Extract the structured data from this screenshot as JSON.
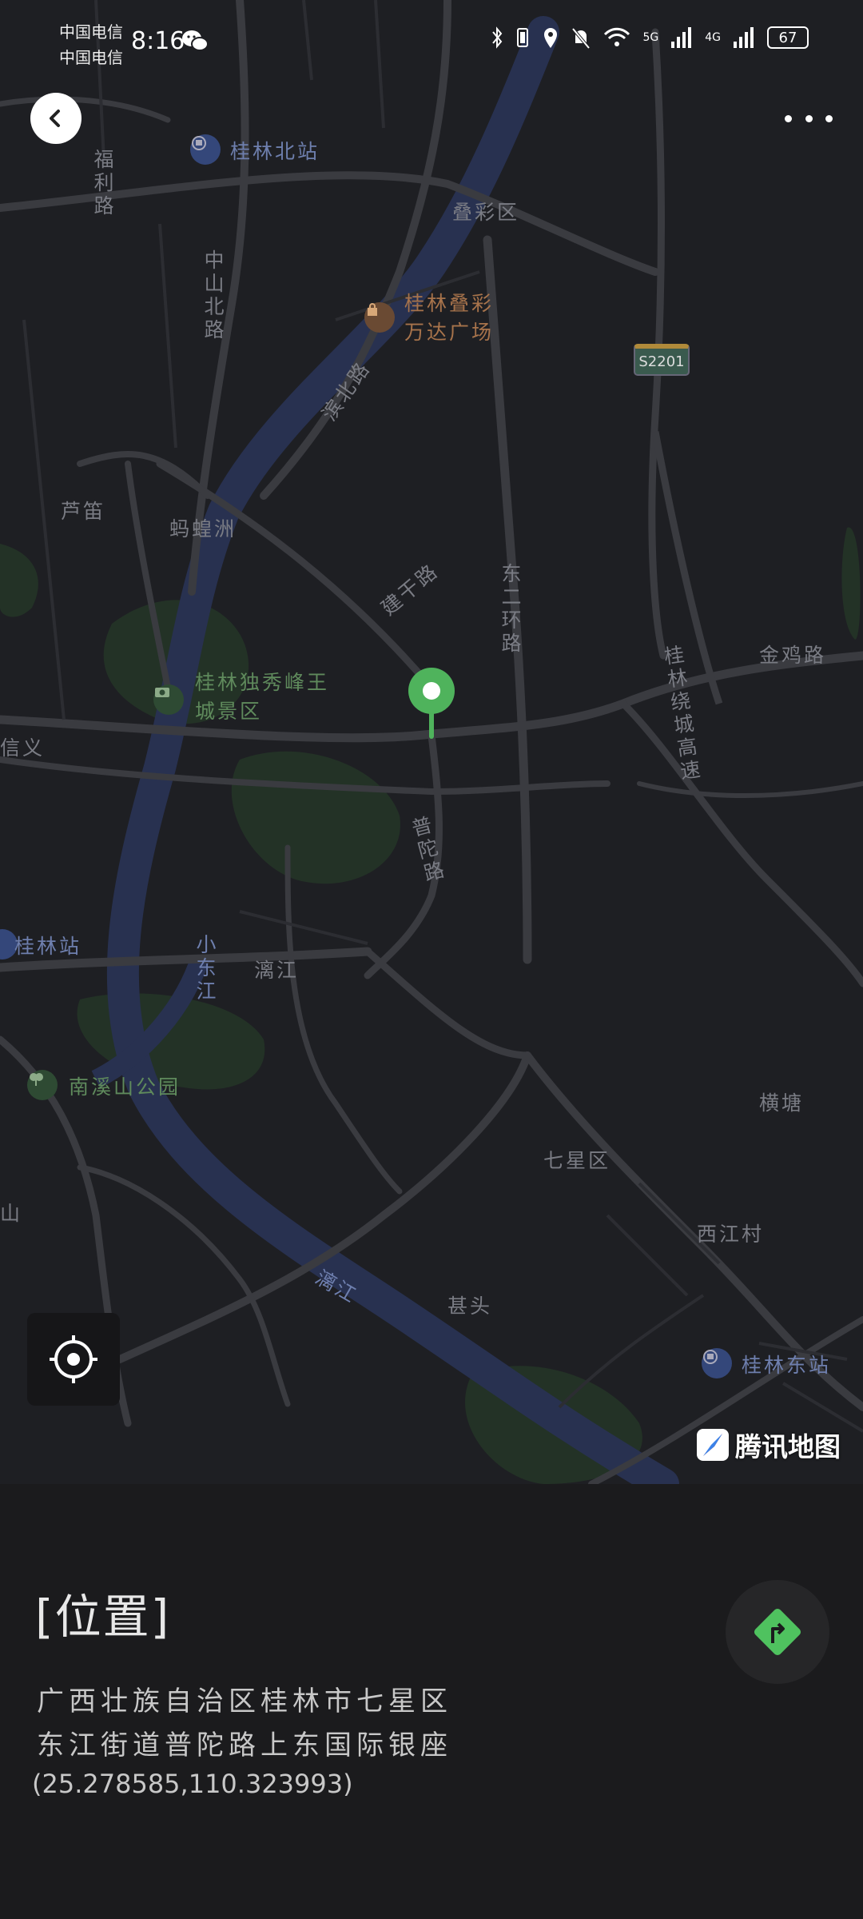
{
  "status_bar": {
    "carrier1": "中国电信",
    "carrier2": "中国电信",
    "time": "8:16",
    "network1": "5G",
    "network2": "4G",
    "battery": "67"
  },
  "map": {
    "labels": {
      "guilin_north": "桂林北站",
      "diecai": "叠彩区",
      "wanda": "桂林叠彩万达广场",
      "fuli": "福利路",
      "zhongshan": "中山北路",
      "binbei": "滨北路",
      "lusheng": "芦笛",
      "zhouzhou": "蚂蝗洲",
      "jiangan": "建干路",
      "dongerhuan": "东二环路",
      "guilin_ring": "桂林绕城高速",
      "jinji": "金鸡路",
      "scenic": "桂林独秀峰王城景区",
      "xinyi": "信义",
      "putuo": "普陀路",
      "guilin_station": "桂林站",
      "xiaodong": "小东江",
      "lijiang": "漓江",
      "nanxi": "南溪山公园",
      "hengtang": "横塘",
      "qixing": "七星区",
      "xijiang": "西江村",
      "shentou": "甚头",
      "lijiang2": "漓江",
      "guilin_east": "桂林东站",
      "shan": "山",
      "s_road": "S2201"
    },
    "brand": "腾讯地图",
    "icons": [
      "back-icon",
      "more-icon",
      "locate-icon",
      "map-pin-icon",
      "navigate-icon"
    ]
  },
  "location": {
    "title": "[位置]",
    "address_line1": "广西壮族自治区桂林市七星区",
    "address_line2": "东江街道普陀路上东国际银座",
    "coordinates": "(25.278585,110.323993)"
  }
}
